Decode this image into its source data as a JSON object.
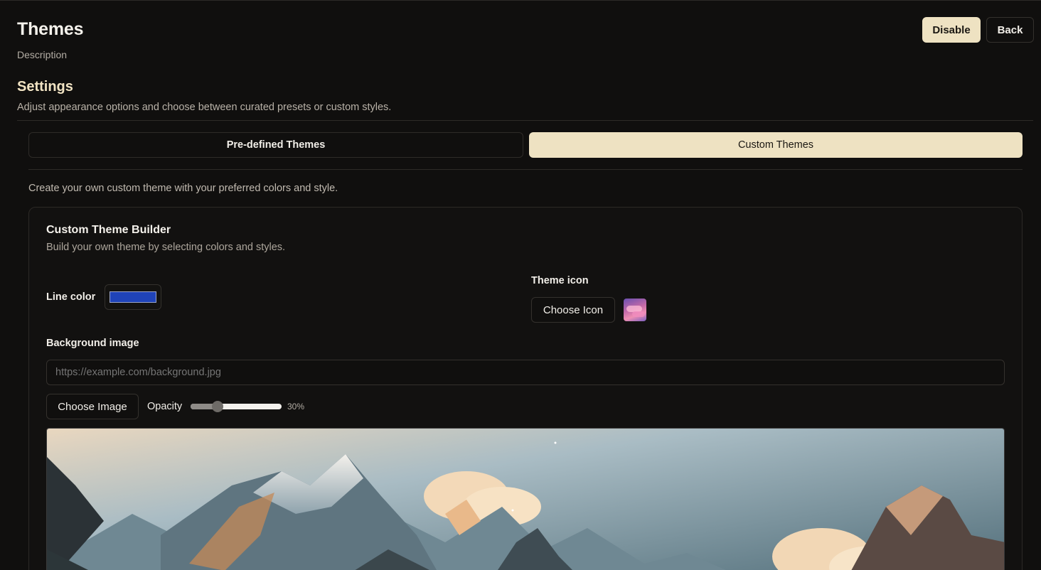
{
  "header": {
    "title": "Themes",
    "description": "Description",
    "disable_label": "Disable",
    "back_label": "Back"
  },
  "settings": {
    "title": "Settings",
    "description": "Adjust appearance options and choose between curated presets or custom styles."
  },
  "tabs": [
    {
      "label": "Pre-defined Themes",
      "active": false
    },
    {
      "label": "Custom Themes",
      "active": true
    }
  ],
  "custom": {
    "description": "Create your own custom theme with your preferred colors and style."
  },
  "builder": {
    "title": "Custom Theme Builder",
    "description": "Build your own theme by selecting colors and styles.",
    "line_color_label": "Line color",
    "line_color": "#1f43b8",
    "theme_icon_label": "Theme icon",
    "choose_icon_label": "Choose Icon",
    "background_image_label": "Background image",
    "background_url_placeholder": "https://example.com/background.jpg",
    "choose_image_label": "Choose Image",
    "opacity_label": "Opacity",
    "opacity_value": 0.3,
    "opacity_text": "30%"
  },
  "colors": {
    "accent": "#eee2c2",
    "background": "#100f0e",
    "settings_heading": "#f1e3c3"
  }
}
